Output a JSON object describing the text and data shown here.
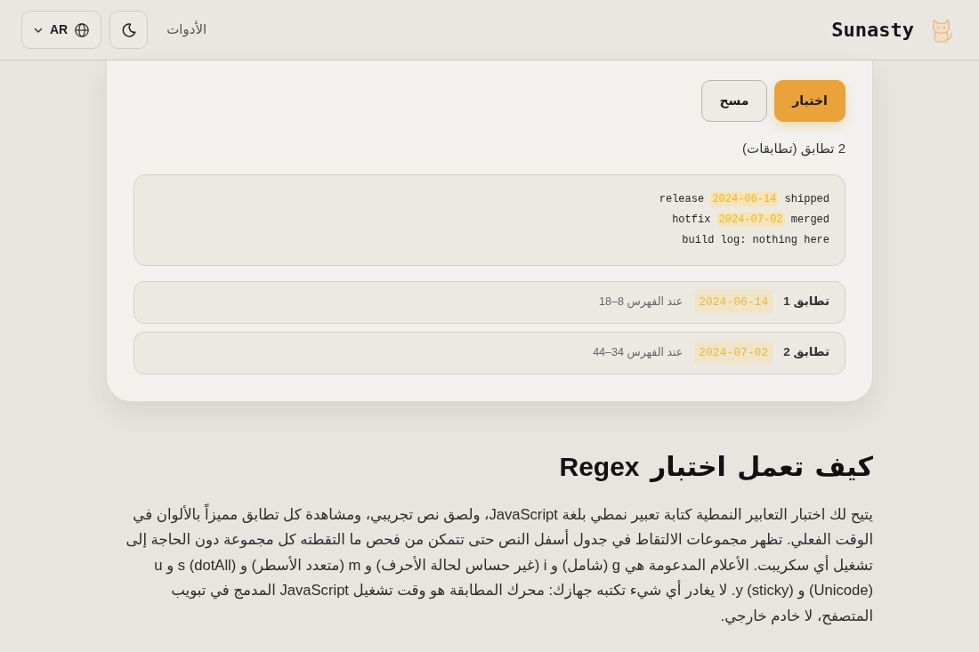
{
  "header": {
    "brand": "Sunasty",
    "nav_link": "الأدوات",
    "language": "AR"
  },
  "tester": {
    "buttons": [
      {
        "label": "اختبار",
        "kind": "primary"
      },
      {
        "label": "مسح",
        "kind": "secondary"
      }
    ],
    "match_count": "2 تطابق (تطابقات)",
    "test_text": [
      {
        "before": "release",
        "match": "2024-06-14",
        "after": "shipped"
      },
      {
        "before": "hotfix",
        "match": "2024-07-02",
        "after": "merged"
      },
      {
        "before": "build log: nothing here"
      }
    ],
    "matches": [
      {
        "label": "تطابق 1",
        "value": "2024-06-14",
        "position": "عند الفهرس 8–18"
      },
      {
        "label": "تطابق 2",
        "value": "2024-07-02",
        "position": "عند الفهرس 34–44"
      }
    ]
  },
  "article": {
    "heading": "كيف تعمل اختبار Regex",
    "paragraphs": [
      "يتيح لك اختبار التعابير النمطية كتابة تعبير نمطي بلغة JavaScript، ولصق نص تجريبي، ومشاهدة كل تطابق مميزاً بالألوان في الوقت الفعلي. تظهر مجموعات الالتقاط في جدول أسفل النص حتى تتمكن من فحص ما التقطته كل مجموعة دون الحاجة إلى تشغيل أي سكريبت. الأعلام المدعومة هي g (شامل) و i (غير حساس لحالة الأحرف) و m (متعدد الأسطر) و s (dotAll) و u (Unicode) و y (sticky). لا يغادر أي شيء تكتبه جهازك: محرك المطابقة هو وقت تشغيل JavaScript المدمج في تبويب المتصفح، لا خادم خارجي."
    ]
  }
}
